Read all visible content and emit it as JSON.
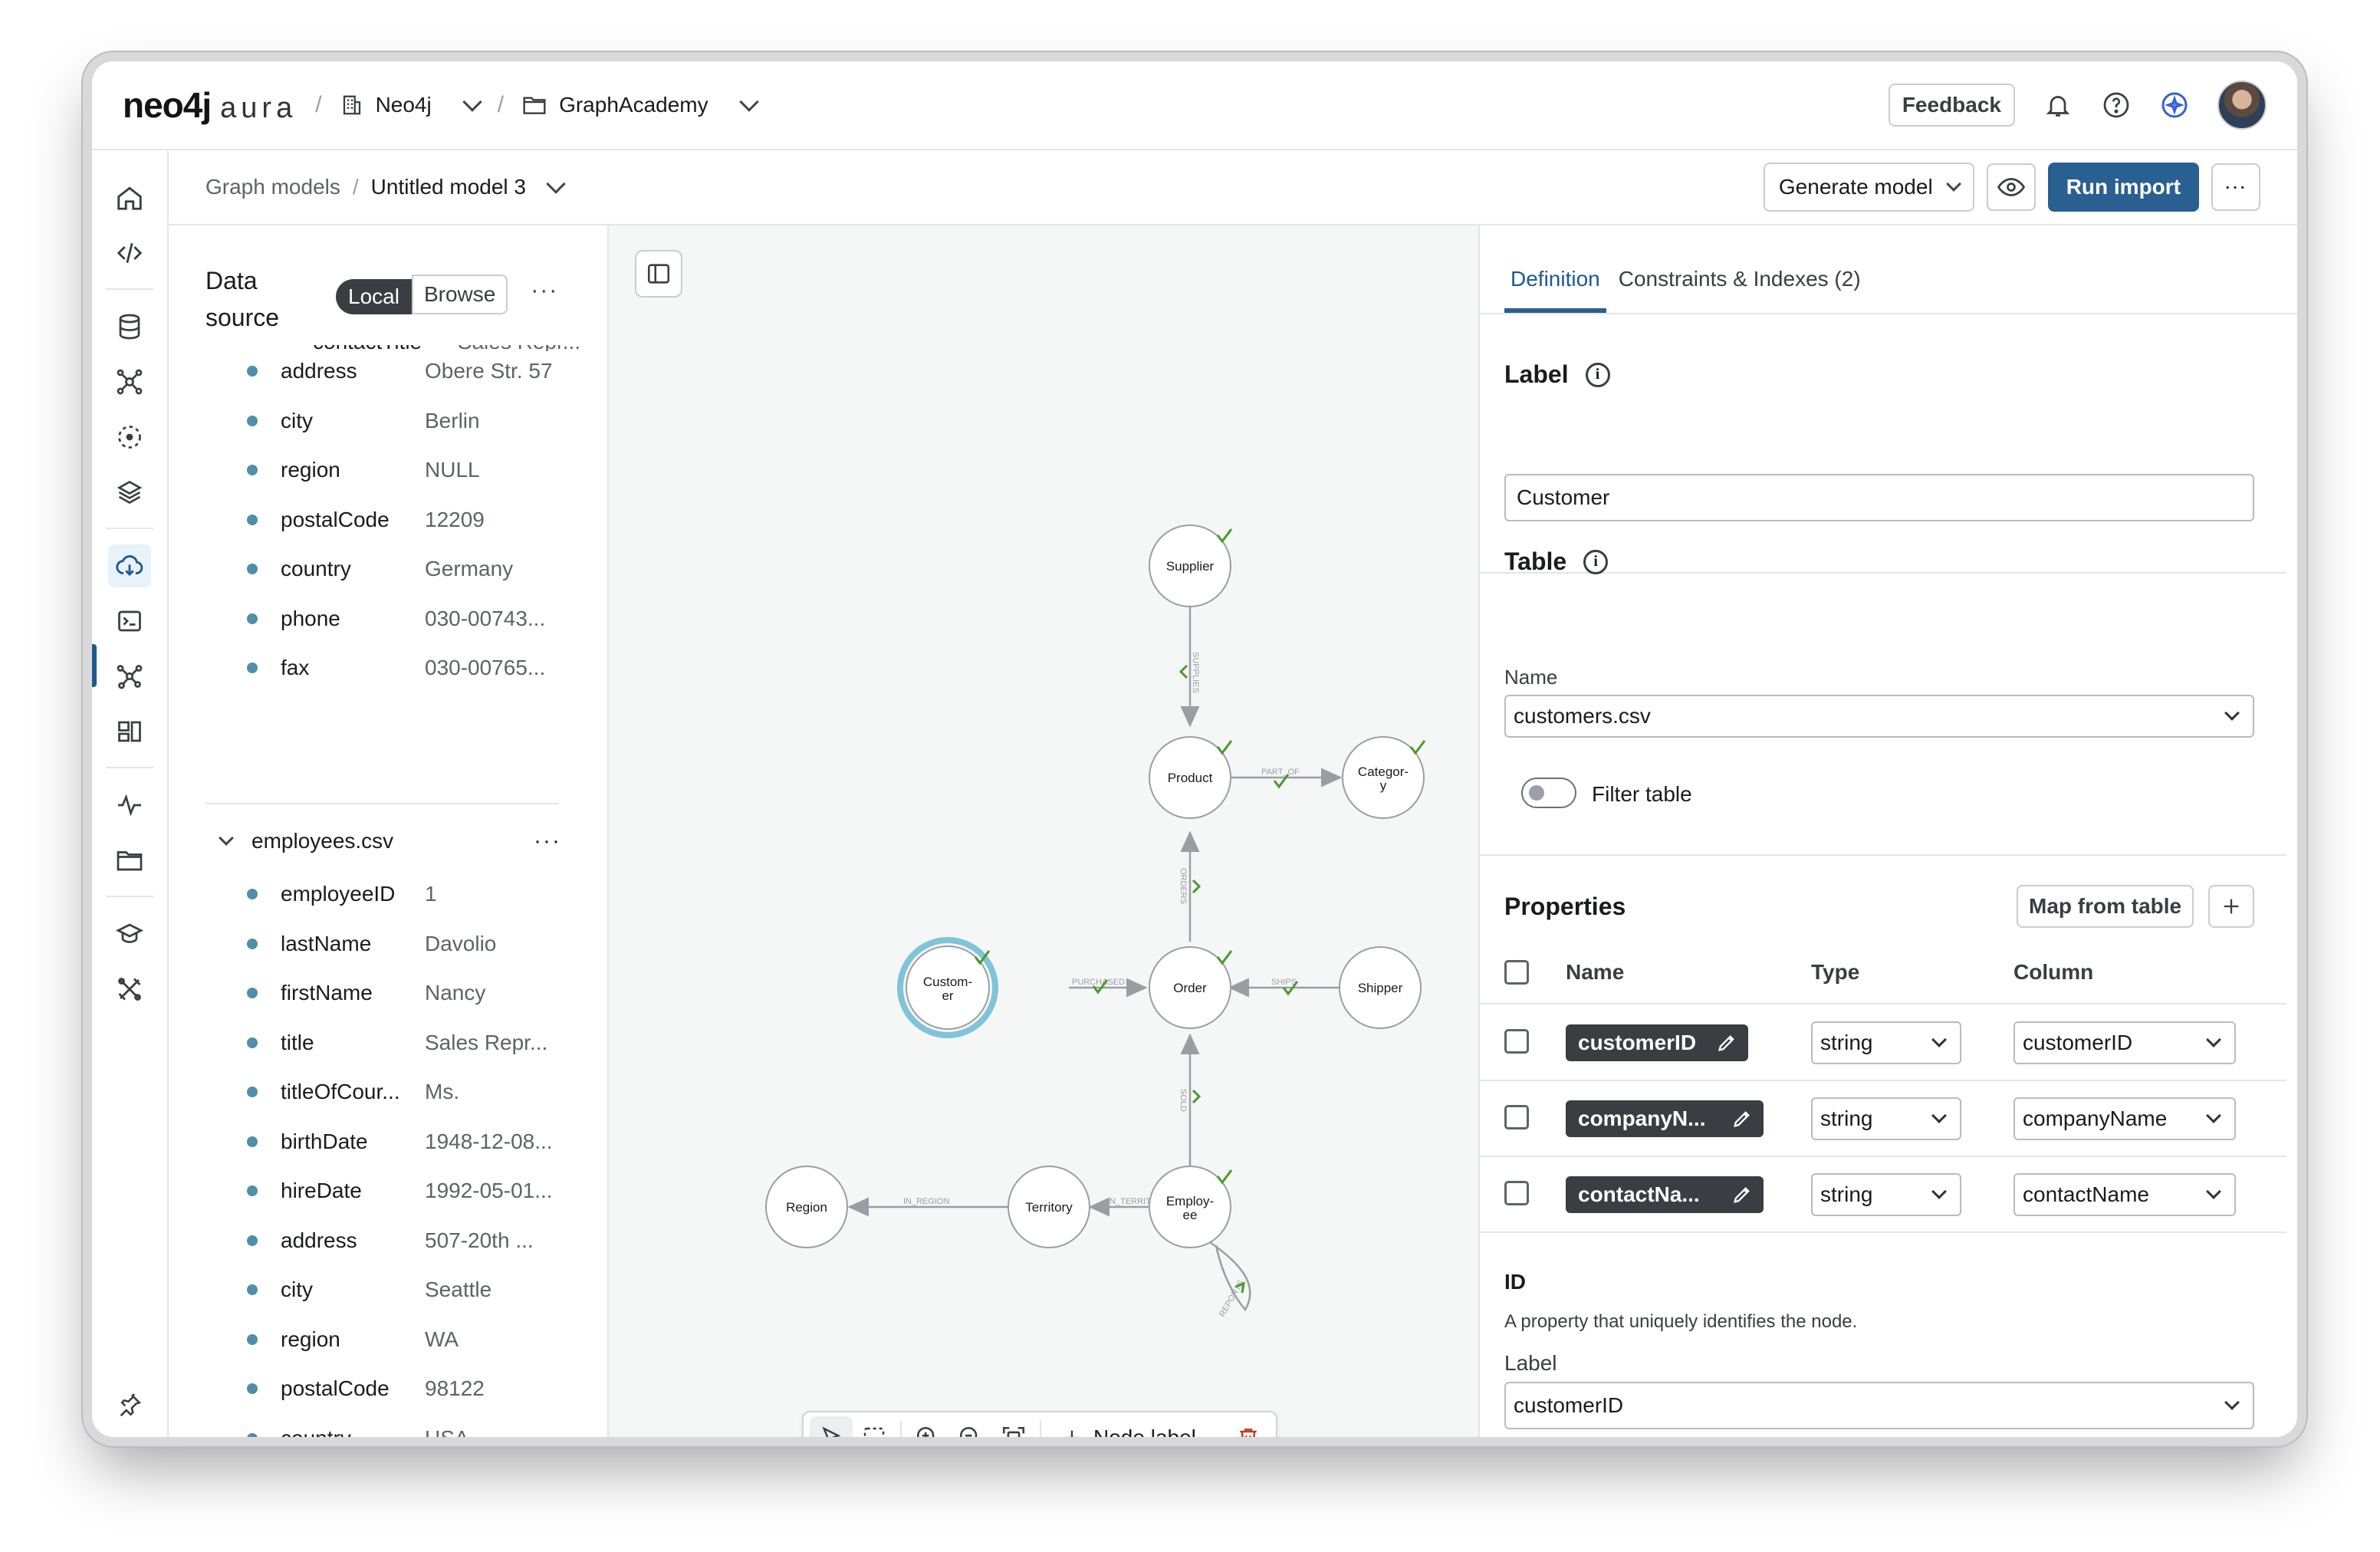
{
  "topbar": {
    "logo_text": "neo4j",
    "logo_suffix": "aura",
    "org": "Neo4j",
    "project": "GraphAcademy",
    "feedback_label": "Feedback"
  },
  "subbar": {
    "crumb_root": "Graph models",
    "crumb_current": "Untitled model 3",
    "generate_label": "Generate model",
    "run_import_label": "Run import"
  },
  "datasource": {
    "title": "Data source",
    "seg_local": "Local",
    "seg_browse": "Browse",
    "customers_partial_fields": [
      {
        "name": "address",
        "value": "Obere Str. 57"
      },
      {
        "name": "city",
        "value": "Berlin"
      },
      {
        "name": "region",
        "value": "NULL"
      },
      {
        "name": "postalCode",
        "value": "12209"
      },
      {
        "name": "country",
        "value": "Germany"
      },
      {
        "name": "phone",
        "value": "030-00743..."
      },
      {
        "name": "fax",
        "value": "030-00765..."
      }
    ],
    "employees_file": "employees.csv",
    "employees_fields": [
      {
        "name": "employeeID",
        "value": "1"
      },
      {
        "name": "lastName",
        "value": "Davolio"
      },
      {
        "name": "firstName",
        "value": "Nancy"
      },
      {
        "name": "title",
        "value": "Sales Repr..."
      },
      {
        "name": "titleOfCour...",
        "value": "Ms."
      },
      {
        "name": "birthDate",
        "value": "1948-12-08..."
      },
      {
        "name": "hireDate",
        "value": "1992-05-01..."
      },
      {
        "name": "address",
        "value": "507-20th ..."
      },
      {
        "name": "city",
        "value": "Seattle"
      },
      {
        "name": "region",
        "value": "WA"
      },
      {
        "name": "postalCode",
        "value": "98122"
      },
      {
        "name": "countrv",
        "value": "USA"
      }
    ]
  },
  "graph": {
    "nodes": {
      "supplier": "Supplier",
      "product": "Product",
      "category_l1": "Categor-",
      "category_l2": "y",
      "customer_l1": "Custom-",
      "customer_l2": "er",
      "order": "Order",
      "shipper": "Shipper",
      "region": "Region",
      "territory": "Territory",
      "employee_l1": "Employ-",
      "employee_l2": "ee"
    },
    "relationships": {
      "supplies": "SUPPLIES",
      "part_of": "PART_OF",
      "ordered": "ORDERS",
      "purchased": "PURCHASED",
      "ships": "SHIPS",
      "sold": "SOLD",
      "in_region": "IN_REGION",
      "in_territory": "IN_TERRITORY",
      "reports": "REPORTS"
    },
    "colors": {
      "valid_check": "#4a9a2c",
      "selected_ring": "#7fc4d8",
      "delete": "#c23a1e"
    }
  },
  "toolbar": {
    "add_label": "Node label"
  },
  "panel": {
    "tab_definition": "Definition",
    "tab_constraints": "Constraints & Indexes (2)",
    "label_title": "Label",
    "label_value": "Customer",
    "table_title": "Table",
    "table_name_label": "Name",
    "table_name_value": "customers.csv",
    "filter_label": "Filter table",
    "properties_title": "Properties",
    "map_from_table": "Map from table",
    "col_name": "Name",
    "col_type": "Type",
    "col_column": "Column",
    "properties": [
      {
        "name": "customerID",
        "type": "string",
        "column": "customerID"
      },
      {
        "name": "companyN...",
        "type": "string",
        "column": "companyName"
      },
      {
        "name": "contactNa...",
        "type": "string",
        "column": "contactName"
      }
    ],
    "id_title": "ID",
    "id_desc": "A property that uniquely identifies the node.",
    "id_label": "Label",
    "id_value": "customerID"
  }
}
